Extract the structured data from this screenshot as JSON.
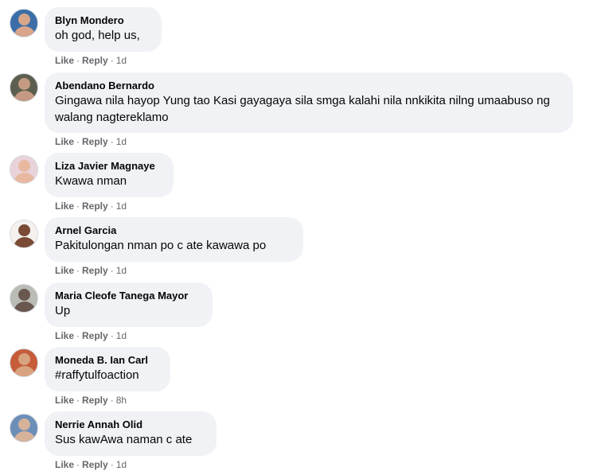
{
  "actions": {
    "like": "Like",
    "reply": "Reply"
  },
  "comments": [
    {
      "author": "Blyn Mondero",
      "text": "oh god, help us,",
      "time": "1d",
      "avatar_colors": [
        "#3b6ea8",
        "#d9a58b"
      ]
    },
    {
      "author": "Abendano Bernardo",
      "text": "Gingawa nila hayop Yung tao Kasi gayagaya sila smga kalahi nila nnkikita nilng umaabuso ng walang nagtereklamo",
      "time": "1d",
      "avatar_colors": [
        "#5d5f4e",
        "#c49b82"
      ]
    },
    {
      "author": "Liza Javier Magnaye",
      "text": "Kwawa nman",
      "time": "1d",
      "avatar_colors": [
        "#e7d3d9",
        "#e8b8a0"
      ]
    },
    {
      "author": "Arnel Garcia",
      "text": "Pakitulongan nman po c ate kawawa po",
      "time": "1d",
      "avatar_colors": [
        "#f4f1ee",
        "#7b4a34"
      ]
    },
    {
      "author": "Maria Cleofe Tanega Mayor",
      "text": "Up",
      "time": "1d",
      "avatar_colors": [
        "#b9bcb5",
        "#6a5850"
      ]
    },
    {
      "author": "Moneda B. Ian Carl",
      "text": "#raffytulfoaction",
      "time": "8h",
      "avatar_colors": [
        "#c65c3a",
        "#d8a37f"
      ]
    },
    {
      "author": "Nerrie Annah Olid",
      "text": "Sus kawAwa naman c ate",
      "time": "1d",
      "avatar_colors": [
        "#6c8fb8",
        "#d6b29a"
      ]
    }
  ]
}
